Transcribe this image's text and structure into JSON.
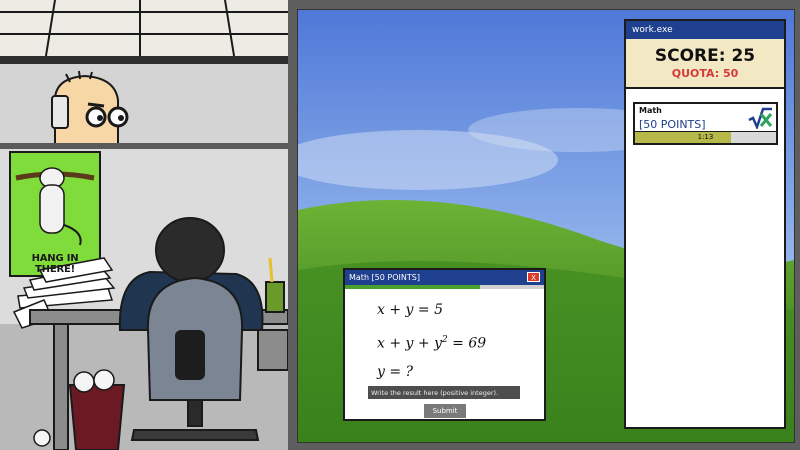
{
  "scene": {
    "poster_caption": "HANG IN THERE!"
  },
  "workexe": {
    "title": "work.exe",
    "score": "SCORE: 25",
    "quota": "QUOTA: 50",
    "task": {
      "name": "Math",
      "points": "[50 POINTS]",
      "timer": "1:13",
      "time_remaining_fraction": 0.68,
      "icon": "square-root-icon"
    }
  },
  "dialog": {
    "title": "Math [50 POINTS]",
    "close_label": "X",
    "progress_fraction": 0.68,
    "equations": {
      "line1": "x + y = 5",
      "line2_main": "x + y + y",
      "line2_exp": "2",
      "line2_rhs": " = 69",
      "line3": "y = ?"
    },
    "input_placeholder": "Write the result here (positive integer).",
    "submit_label": "Submit"
  },
  "colors": {
    "titlebar": "#1f3f8f",
    "quota": "#d63a3a",
    "close_button": "#d83a2c",
    "progress_green": "#4aa02c",
    "timer_fill": "#b6b84a"
  }
}
